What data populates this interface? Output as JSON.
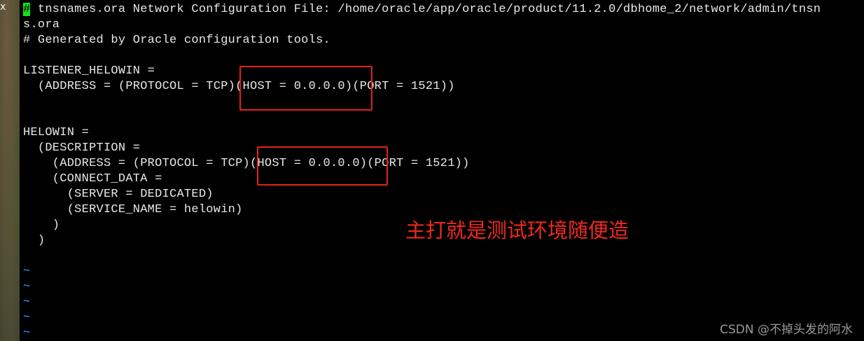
{
  "desktop": {
    "close_glyph": "x"
  },
  "editor": {
    "cursor_char": "#",
    "lines": [
      " tnsnames.ora Network Configuration File: /home/oracle/app/oracle/product/11.2.0/dbhome_2/network/admin/tnsn",
      "s.ora",
      "# Generated by Oracle configuration tools.",
      "",
      "LISTENER_HELOWIN =",
      "  (ADDRESS = (PROTOCOL = TCP)(HOST = 0.0.0.0)(PORT = 1521))",
      "",
      "",
      "HELOWIN =",
      "  (DESCRIPTION =",
      "    (ADDRESS = (PROTOCOL = TCP)(HOST = 0.0.0.0)(PORT = 1521))",
      "    (CONNECT_DATA =",
      "      (SERVER = DEDICATED)",
      "      (SERVICE_NAME = helowin)",
      "    )",
      "  )",
      "",
      "~",
      "~",
      "~",
      "~",
      "~"
    ],
    "tilde_color": "#2e6bd8",
    "text_color": "#e8e8e8",
    "cursor_color": "#18e018"
  },
  "annotation": {
    "text": "主打就是测试环境随便造",
    "color": "#f0281e",
    "highlight_color": "#e5201a"
  },
  "watermark": {
    "text": "CSDN @不掉头发的阿水"
  }
}
